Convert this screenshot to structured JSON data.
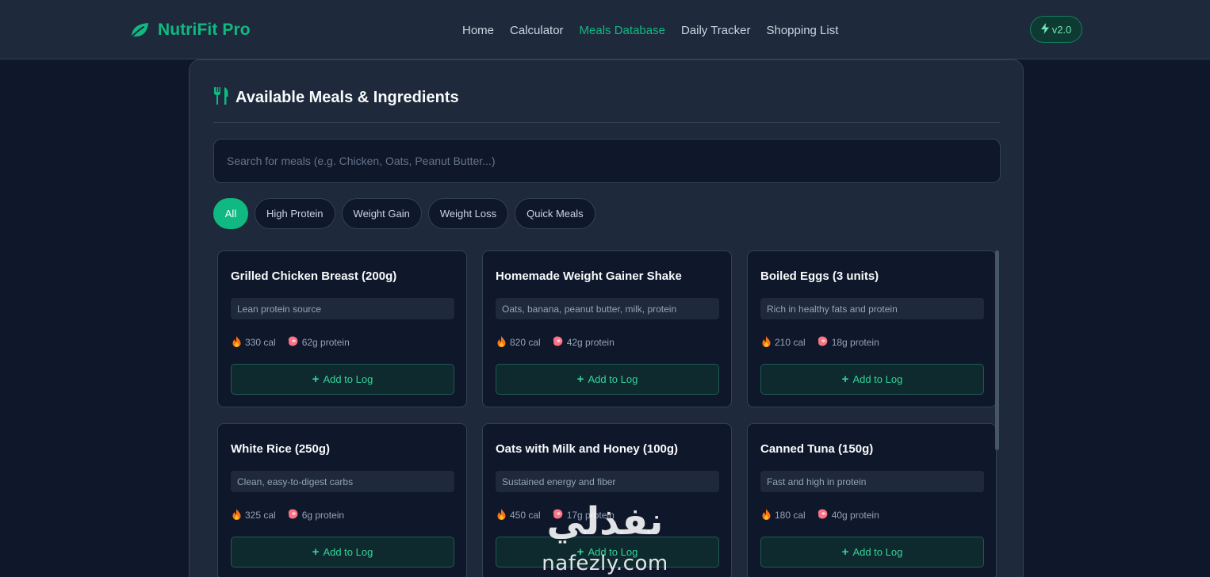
{
  "header": {
    "brand": "NutriFit Pro",
    "nav": [
      {
        "label": "Home",
        "active": false
      },
      {
        "label": "Calculator",
        "active": false
      },
      {
        "label": "Meals Database",
        "active": true
      },
      {
        "label": "Daily Tracker",
        "active": false
      },
      {
        "label": "Shopping List",
        "active": false
      }
    ],
    "version": "v2.0"
  },
  "panel": {
    "title": "Available Meals & Ingredients",
    "search_placeholder": "Search for meals (e.g. Chicken, Oats, Peanut Butter...)",
    "filters": [
      {
        "label": "All",
        "active": true
      },
      {
        "label": "High Protein",
        "active": false
      },
      {
        "label": "Weight Gain",
        "active": false
      },
      {
        "label": "Weight Loss",
        "active": false
      },
      {
        "label": "Quick Meals",
        "active": false
      }
    ],
    "add_label": "Add to Log",
    "meals": [
      {
        "name": "Grilled Chicken Breast (200g)",
        "desc": "Lean protein source",
        "cal": "330 cal",
        "protein": "62g protein"
      },
      {
        "name": "Homemade Weight Gainer Shake",
        "desc": "Oats, banana, peanut butter, milk, protein",
        "cal": "820 cal",
        "protein": "42g protein"
      },
      {
        "name": "Boiled Eggs (3 units)",
        "desc": "Rich in healthy fats and protein",
        "cal": "210 cal",
        "protein": "18g protein"
      },
      {
        "name": "White Rice (250g)",
        "desc": "Clean, easy-to-digest carbs",
        "cal": "325 cal",
        "protein": "6g protein"
      },
      {
        "name": "Oats with Milk and Honey (100g)",
        "desc": "Sustained energy and fiber",
        "cal": "450 cal",
        "protein": "17g protein"
      },
      {
        "name": "Canned Tuna (150g)",
        "desc": "Fast and high in protein",
        "cal": "180 cal",
        "protein": "40g protein"
      }
    ]
  },
  "watermark": {
    "arabic": "نفذلي",
    "latin": "nafezly.com"
  },
  "colors": {
    "accent": "#10b981",
    "background": "#0f172a",
    "surface": "#1e293b"
  },
  "icons": {
    "brand": "leaf-icon",
    "version": "bolt-icon",
    "title": "utensils-icon",
    "calories": "fire-icon",
    "protein": "meat-icon",
    "add": "plus-icon"
  }
}
